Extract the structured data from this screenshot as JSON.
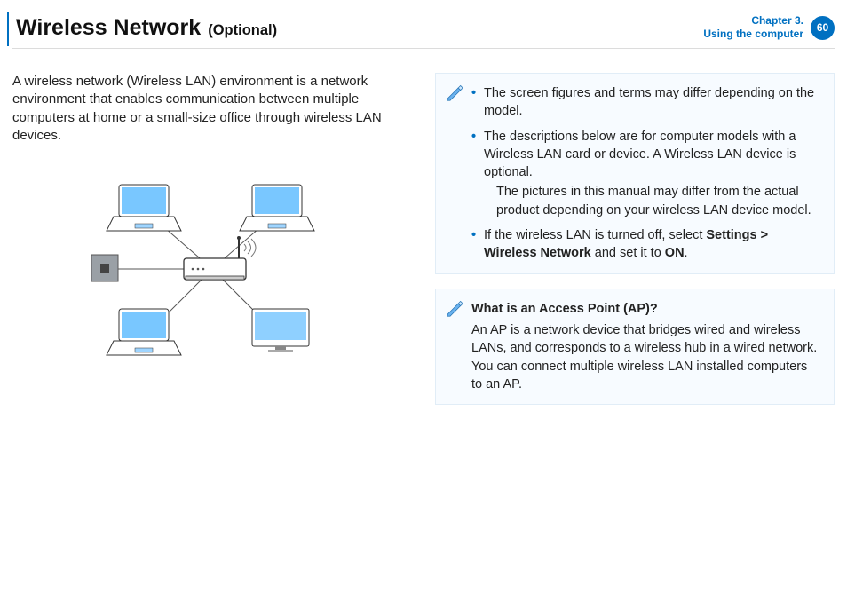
{
  "header": {
    "title": "Wireless Network",
    "title_note": "(Optional)",
    "chapter_line1": "Chapter 3.",
    "chapter_line2": "Using the computer",
    "page_number": "60"
  },
  "intro": "A wireless network (Wireless LAN) environment is a network environment that enables communication between multiple computers at home or a small-size office through wireless LAN devices.",
  "notes": {
    "items": [
      {
        "text": "The screen figures and terms may differ depending on the model."
      },
      {
        "text": "The descriptions below are for computer models with a Wireless LAN card or device. A Wireless LAN device is optional.",
        "sub": "The pictures in this manual may differ from the actual product depending on your wireless LAN device model."
      },
      {
        "pre": "If the wireless LAN is turned off, select ",
        "b1": "Settings > Wireless Network",
        "mid": " and set it to ",
        "b2": "ON",
        "post": "."
      }
    ]
  },
  "ap_box": {
    "title": "What is an Access Point (AP)?",
    "body": "An AP is a network device that bridges wired and wireless LANs, and corresponds to a wireless hub in a wired network. You can connect multiple wireless LAN installed computers to an AP."
  }
}
